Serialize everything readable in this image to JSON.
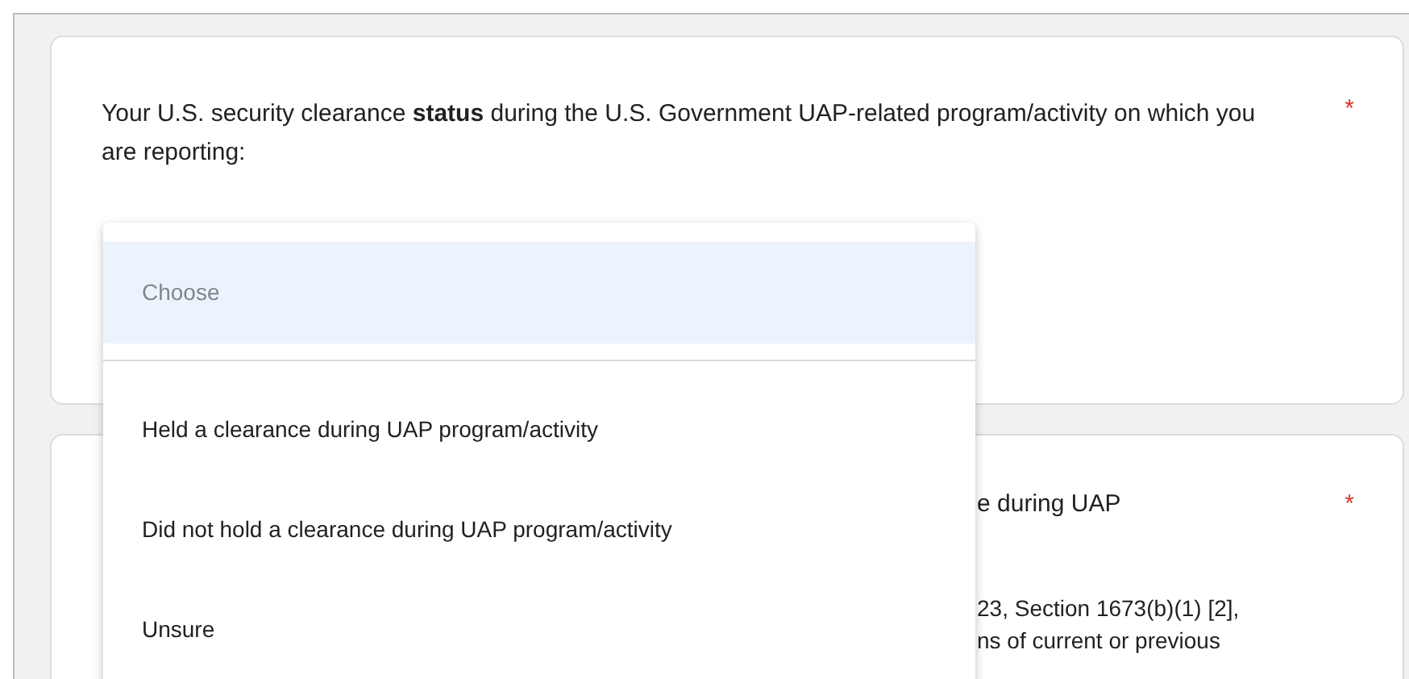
{
  "question_1": {
    "text": "Your U.S. security clearance **status** during the  U.S. Government UAP-related program/activity on which you are reporting:",
    "required_mark": "*"
  },
  "dropdown": {
    "options": [
      {
        "label": "Choose",
        "kind": "placeholder",
        "selected": true
      },
      {
        "label": "Held a clearance during UAP program/activity",
        "kind": "option",
        "selected": false
      },
      {
        "label": "Did not hold a clearance during UAP program/activity",
        "kind": "option",
        "selected": false
      },
      {
        "label": "Unsure",
        "kind": "option",
        "selected": false
      }
    ]
  },
  "question_2": {
    "title_fragment": "e during  UAP",
    "required_mark": "*",
    "description_lines": [
      "23, Section 1673(b)(1)  [2],",
      "ns of current or previous"
    ]
  }
}
